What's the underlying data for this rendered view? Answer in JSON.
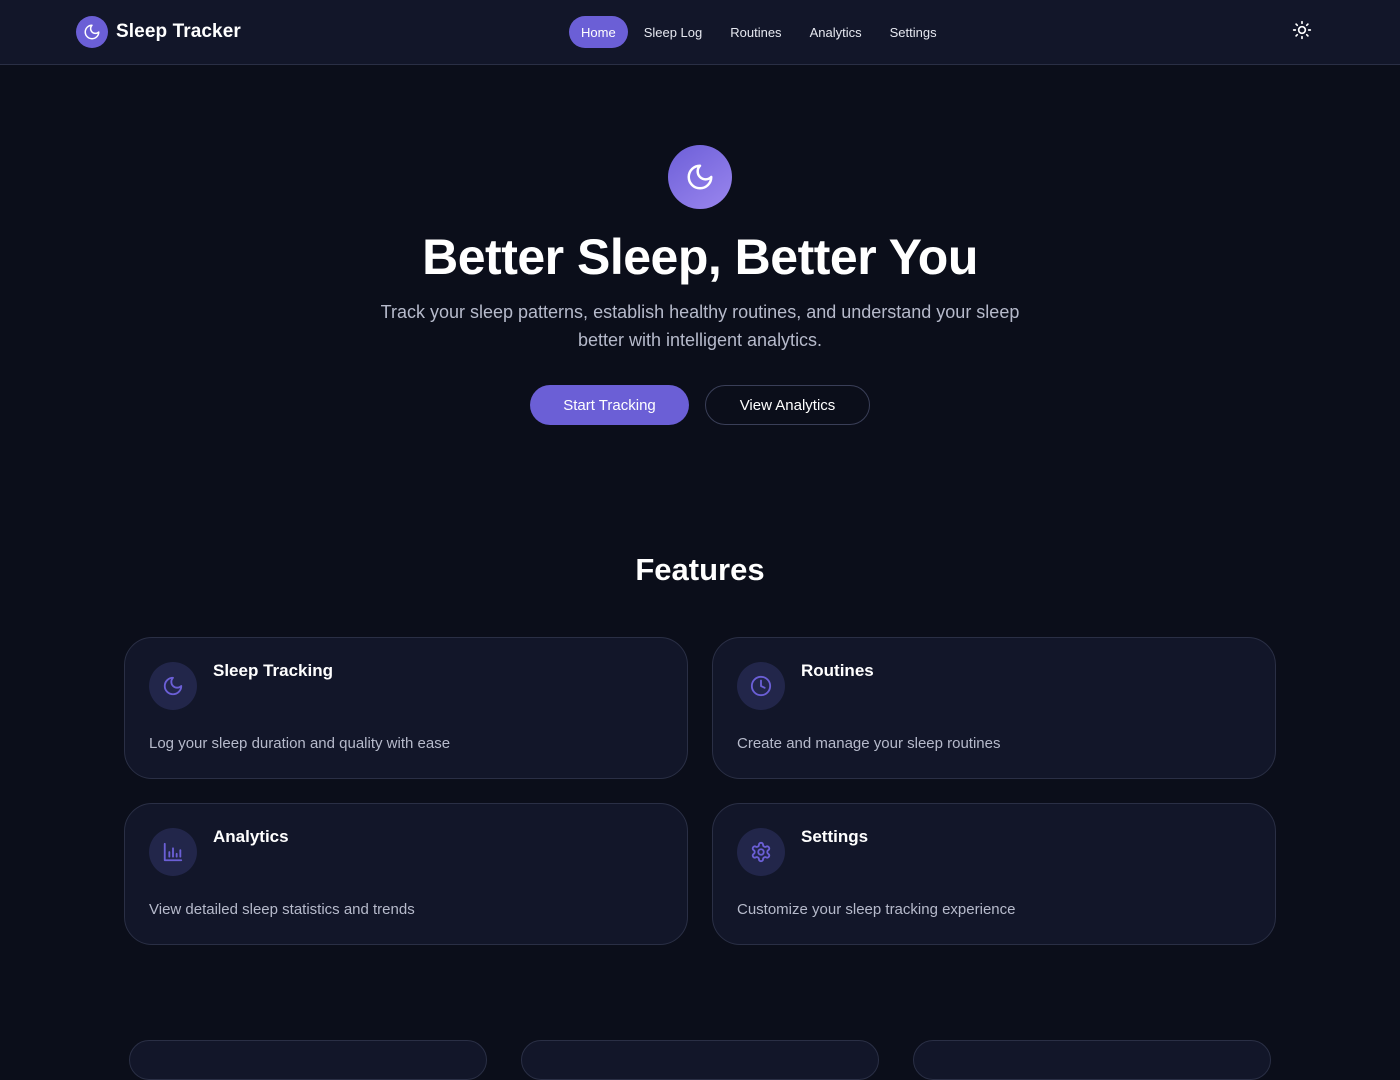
{
  "header": {
    "brand_name": "Sleep Tracker",
    "nav": [
      {
        "label": "Home",
        "active": true
      },
      {
        "label": "Sleep Log",
        "active": false
      },
      {
        "label": "Routines",
        "active": false
      },
      {
        "label": "Analytics",
        "active": false
      },
      {
        "label": "Settings",
        "active": false
      }
    ],
    "theme_icon": "sun-icon"
  },
  "hero": {
    "icon": "moon-icon",
    "title": "Better Sleep, Better You",
    "subtitle": "Track your sleep patterns, establish healthy routines, and understand your sleep better with intelligent analytics.",
    "primary_button": "Start Tracking",
    "secondary_button": "View Analytics"
  },
  "features": {
    "title": "Features",
    "cards": [
      {
        "icon": "moon-icon",
        "title": "Sleep Tracking",
        "description": "Log your sleep duration and quality with ease"
      },
      {
        "icon": "clock-icon",
        "title": "Routines",
        "description": "Create and manage your sleep routines"
      },
      {
        "icon": "bar-chart-icon",
        "title": "Analytics",
        "description": "View detailed sleep statistics and trends"
      },
      {
        "icon": "gear-icon",
        "title": "Settings",
        "description": "Customize your sleep tracking experience"
      }
    ]
  },
  "colors": {
    "background": "#0b0e1a",
    "surface": "#121629",
    "accent": "#6b5fd6",
    "text_muted": "#b6bacb"
  }
}
